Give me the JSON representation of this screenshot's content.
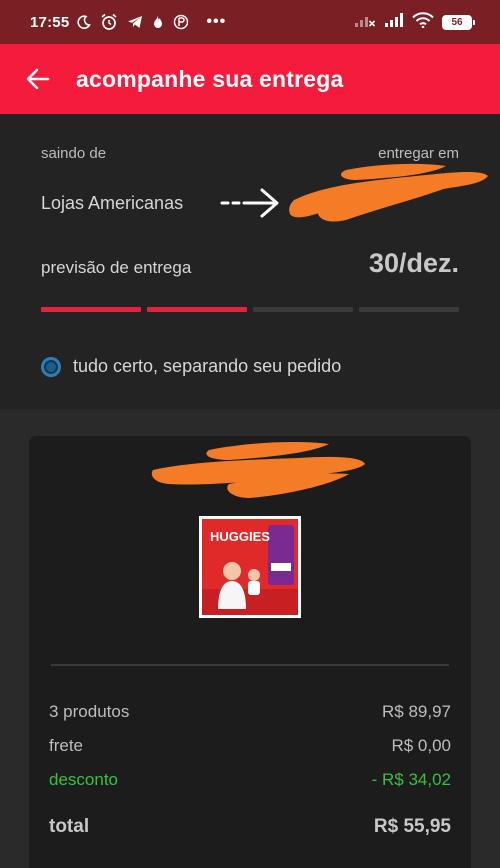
{
  "status_bar": {
    "time": "17:55",
    "battery": "56",
    "more": "•••",
    "icons": [
      "moon-icon",
      "alarm-icon",
      "telegram-icon",
      "tinder-icon",
      "app-icon",
      "signal-x-icon",
      "signal-icon",
      "wifi-icon",
      "battery-icon"
    ]
  },
  "header": {
    "title": "acompanhe sua entrega",
    "back_icon": "arrow-left-icon"
  },
  "tracking": {
    "from_label": "saindo de",
    "to_label": "entregar em",
    "origin": "Lojas Americanas",
    "forecast_label": "previsão de entrega",
    "forecast_date": "30/dez.",
    "progress": {
      "segments": 4,
      "completed": 2
    },
    "status": "tudo certo, separando seu pedido"
  },
  "order": {
    "product_brand": "HUGGIES",
    "summary": [
      {
        "label": "3 produtos",
        "value": "R$ 89,97"
      },
      {
        "label": "frete",
        "value": "R$ 0,00"
      },
      {
        "label": "desconto",
        "value": "- R$ 34,02"
      },
      {
        "label": "total",
        "value": "R$ 55,95"
      }
    ]
  },
  "colors": {
    "status_bar": "#7a1f24",
    "app_bar": "#f51b3d",
    "progress_active": "#e8213f",
    "discount": "#36c23f",
    "redaction": "#f47c27"
  }
}
